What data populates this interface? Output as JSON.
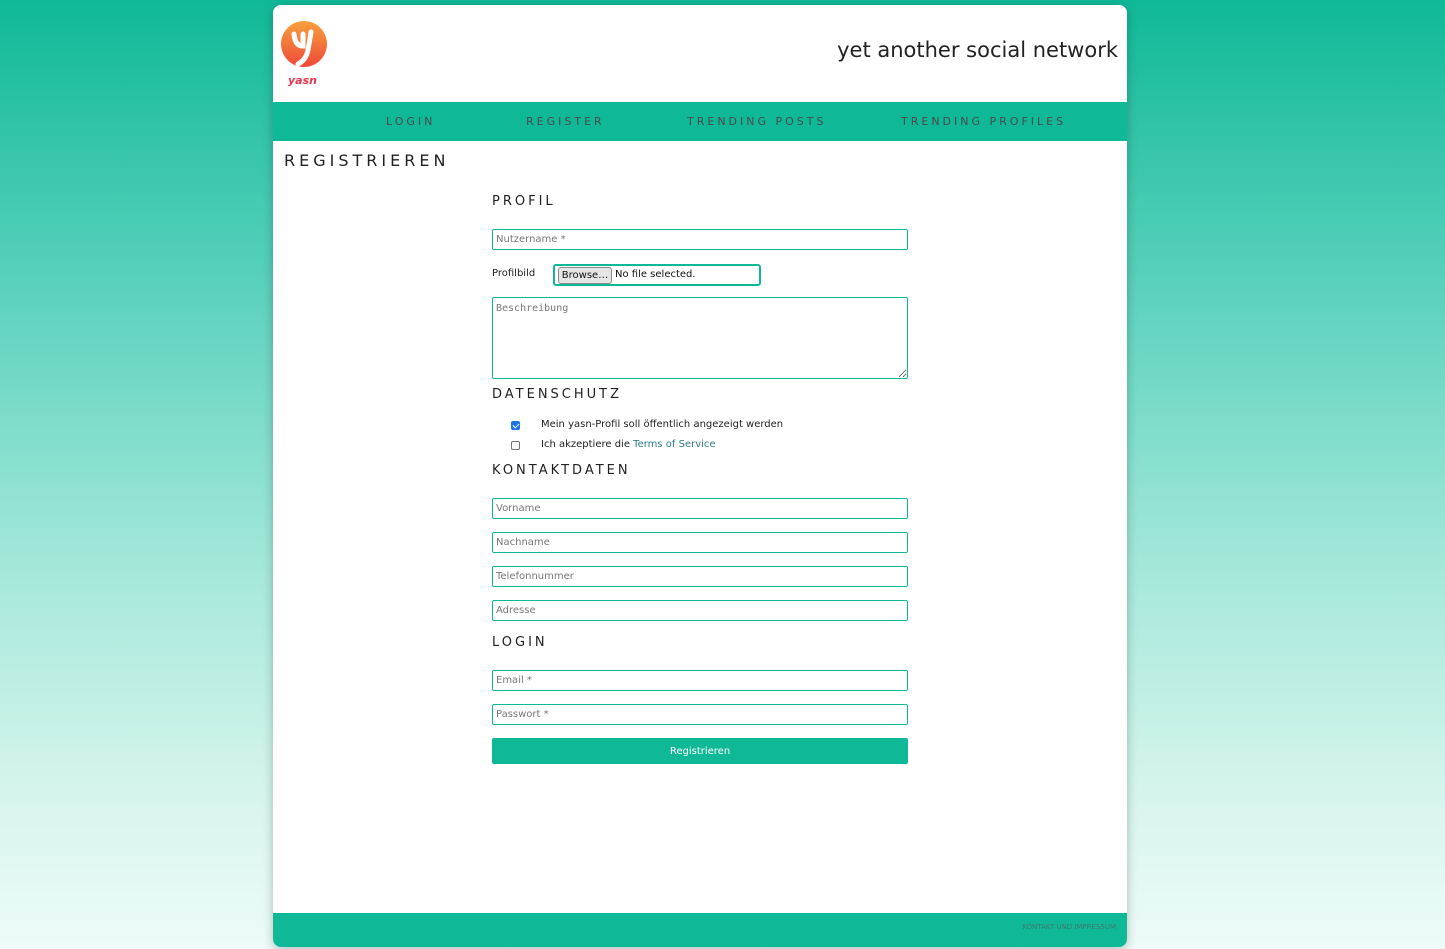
{
  "header": {
    "logo_text": "yasn",
    "site_title": "yet another social network"
  },
  "nav": {
    "items": [
      {
        "label": "LOGIN"
      },
      {
        "label": "REGISTER"
      },
      {
        "label": "TRENDING POSTS"
      },
      {
        "label": "TRENDING PROFILES"
      }
    ]
  },
  "page_title": "REGISTRIEREN",
  "profil": {
    "title": "PROFIL",
    "username_placeholder": "Nutzername *",
    "profile_image_label": "Profilbild",
    "browse_label": "Browse…",
    "file_status": "No file selected.",
    "description_placeholder": "Beschreibung"
  },
  "datenschutz": {
    "title": "DATENSCHUTZ",
    "public_profile_label": "Mein yasn-Profil soll öffentlich angezeigt werden",
    "public_profile_checked": true,
    "terms_prefix": "Ich akzeptiere die",
    "terms_link": "Terms of Service",
    "terms_checked": false
  },
  "kontaktdaten": {
    "title": "KONTAKTDATEN",
    "firstname_placeholder": "Vorname",
    "lastname_placeholder": "Nachname",
    "phone_placeholder": "Telefonnummer",
    "address_placeholder": "Adresse"
  },
  "login": {
    "title": "LOGIN",
    "email_placeholder": "Email *",
    "password_placeholder": "Passwort *",
    "submit_label": "Registrieren"
  },
  "footer": {
    "link_label": "KONTAKT UND IMPRESSUM"
  },
  "colors": {
    "accent": "#0fb998",
    "logo_orange": "#f46b3b",
    "logo_red": "#e8344e"
  }
}
